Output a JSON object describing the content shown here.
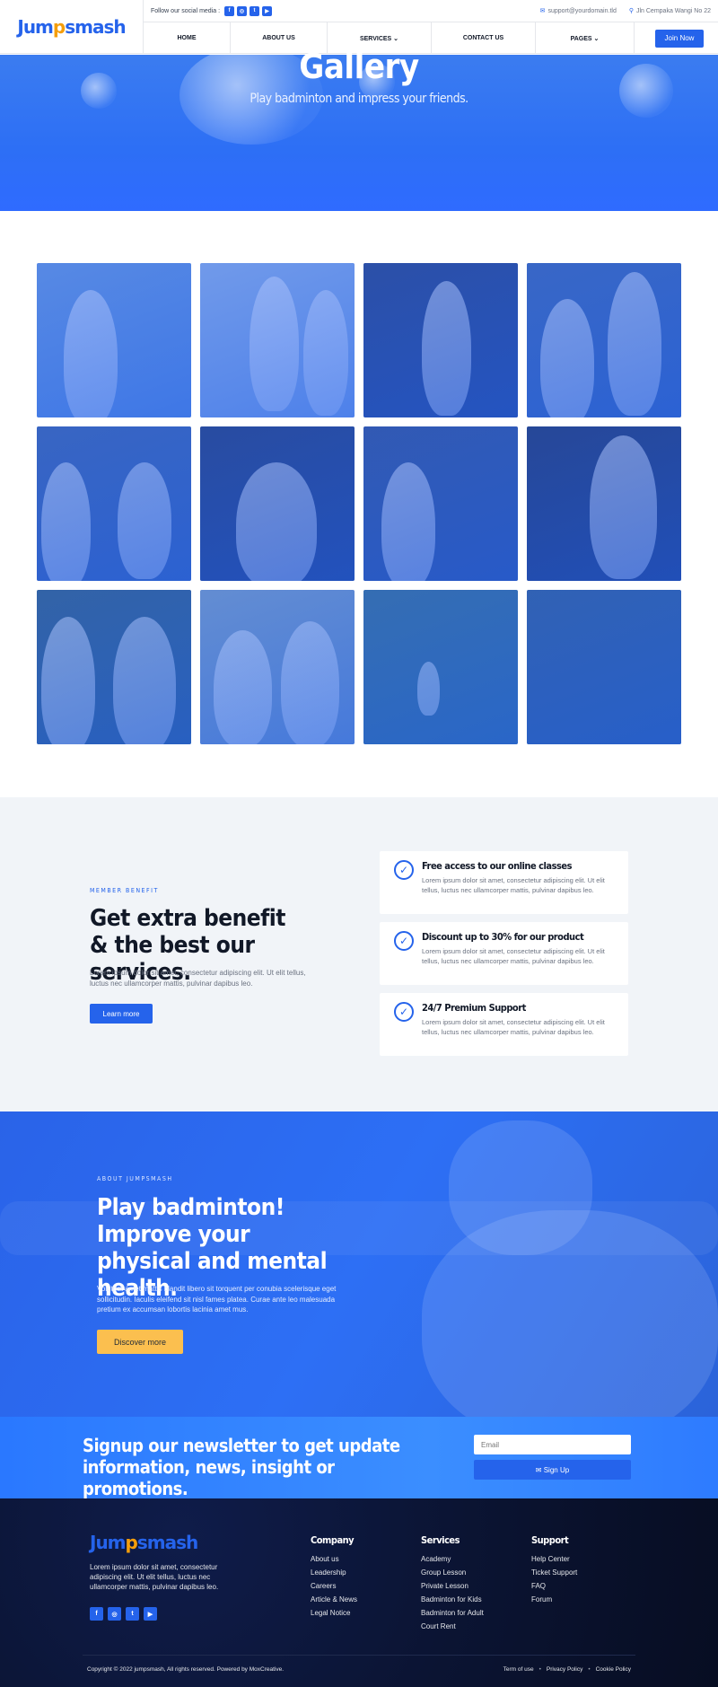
{
  "brand": {
    "name_part1": "Jum",
    "name_dot": "p",
    "name_part2": "smash"
  },
  "topbar": {
    "follow_label": "Follow our social media :",
    "email": "support@yourdomain.tld",
    "address": "Jln Cempaka Wangi No 22"
  },
  "social": {
    "facebook": "f",
    "instagram": "◎",
    "twitter": "t",
    "youtube": "▶"
  },
  "nav": {
    "items": [
      "HOME",
      "ABOUT US",
      "SERVICES ⌄",
      "CONTACT US",
      "PAGES ⌄"
    ],
    "join": "Join Now"
  },
  "hero": {
    "title": "Gallery",
    "subtitle": "Play badminton and impress your friends."
  },
  "benefit": {
    "tag": "MEMBER BENEFIT",
    "title": "Get extra benefit & the best our services.",
    "desc": "Lorem ipsum dolor sit amet, consectetur adipiscing elit. Ut elit tellus, luctus nec ullamcorper mattis, pulvinar dapibus leo.",
    "button": "Learn more",
    "cards": [
      {
        "title": "Free access to our online classes",
        "desc": "Lorem ipsum dolor sit amet, consectetur adipiscing elit. Ut elit tellus, luctus nec ullamcorper mattis, pulvinar dapibus leo."
      },
      {
        "title": "Discount up to 30% for our product",
        "desc": "Lorem ipsum dolor sit amet, consectetur adipiscing elit. Ut elit tellus, luctus nec ullamcorper mattis, pulvinar dapibus leo."
      },
      {
        "title": "24/7 Premium Support",
        "desc": "Lorem ipsum dolor sit amet, consectetur adipiscing elit. Ut elit tellus, luctus nec ullamcorper mattis, pulvinar dapibus leo."
      }
    ]
  },
  "about": {
    "tag": "ABOUT JUMPSMASH",
    "title": "Play badminton! Improve your physical and mental health.",
    "desc": "Volutpat amet mattis blandit libero sit torquent per conubia scelerisque eget sollicitudin. Iaculis eleifend sit nisl fames platea. Curae ante leo malesuada pretium ex accumsan lobortis lacinia amet mus.",
    "button": "Discover more"
  },
  "newsletter": {
    "title": "Signup our newsletter to get update information, news, insight or promotions.",
    "placeholder": "Email",
    "button": "✉  Sign Up"
  },
  "footer": {
    "desc": "Lorem ipsum dolor sit amet, consectetur adipiscing elit. Ut elit tellus, luctus nec ullamcorper mattis, pulvinar dapibus leo.",
    "company": {
      "title": "Company",
      "links": [
        "About us",
        "Leadership",
        "Careers",
        "Article & News",
        "Legal Notice"
      ]
    },
    "services": {
      "title": "Services",
      "links": [
        "Academy",
        "Group Lesson",
        "Private Lesson",
        "Badminton for Kids",
        "Badminton for Adult",
        "Court Rent"
      ]
    },
    "support": {
      "title": "Support",
      "links": [
        "Help Center",
        "Ticket Support",
        "FAQ",
        "Forum"
      ]
    },
    "copyright": "Copyright © 2022 jumpsmash, All rights reserved. Powered by MoxCreative.",
    "legal": [
      "Term of use",
      "Privacy Policy",
      "Cookie Policy"
    ],
    "legal_sep": "•"
  },
  "colors": {
    "primary": "#2563eb",
    "accent": "#fbbf4f",
    "footer_bg": "#0b1433"
  }
}
